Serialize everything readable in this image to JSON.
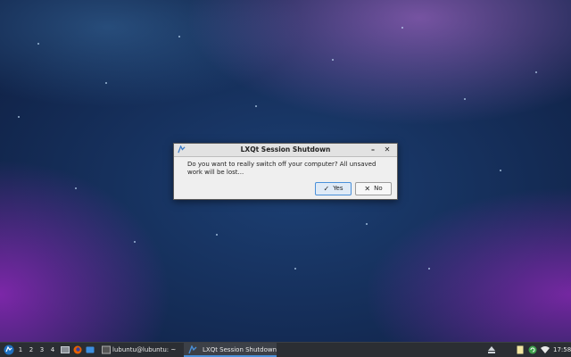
{
  "dialog": {
    "title": "LXQt Session Shutdown",
    "minimize_glyph": "–",
    "close_glyph": "✕",
    "message": "Do you want to really switch off your computer? All unsaved work will be lost...",
    "yes_label": "Yes",
    "no_label": "No",
    "yes_icon": "✓",
    "no_icon": "✕"
  },
  "taskbar": {
    "workspaces": [
      "1",
      "2",
      "3",
      "4"
    ],
    "tasks": [
      {
        "label": "lubuntu@lubuntu: ~",
        "icon": "terminal-icon",
        "active": false
      },
      {
        "label": "LXQt Session Shutdown",
        "icon": "lxqt-icon",
        "active": true
      }
    ],
    "clock": "17:58"
  },
  "colors": {
    "accent": "#4a90d9",
    "taskbar_bg": "#2b2e33",
    "dialog_bg": "#efefef"
  }
}
